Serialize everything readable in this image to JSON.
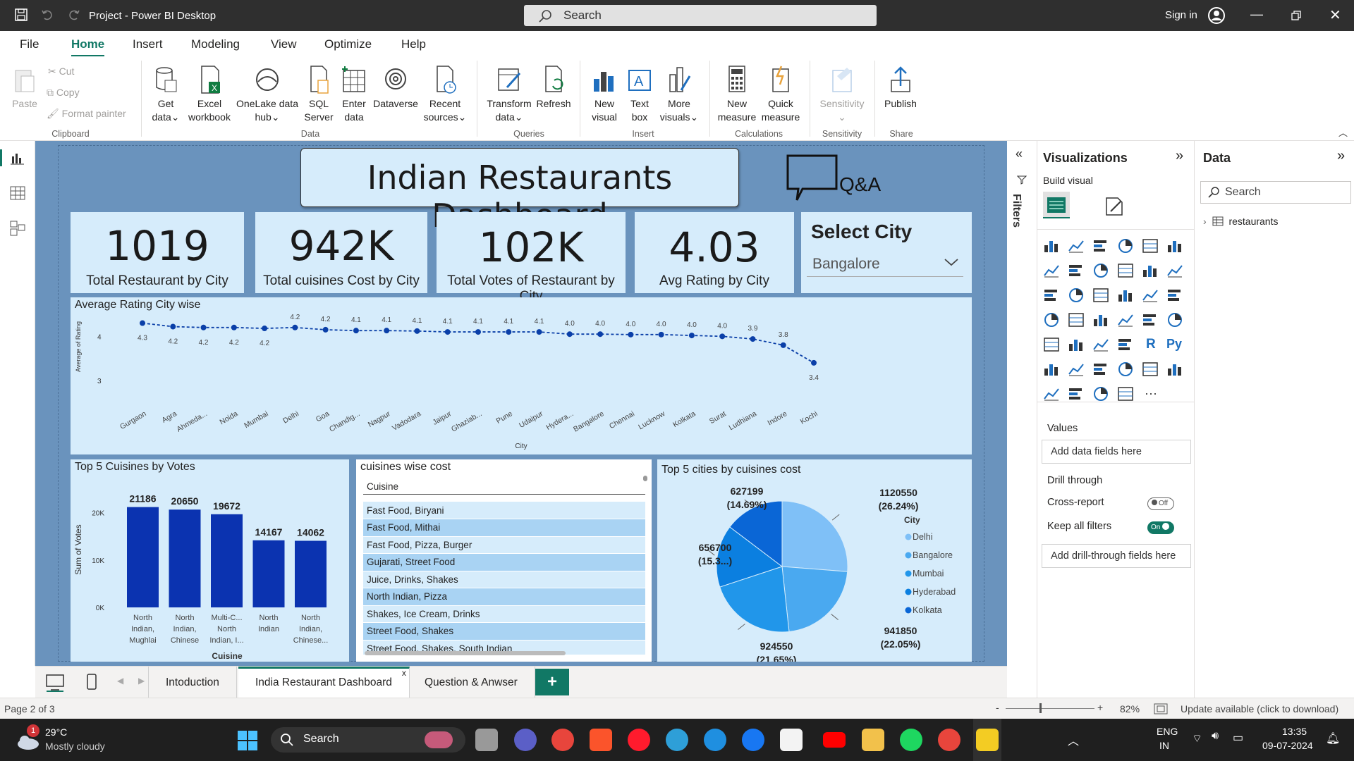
{
  "window": {
    "title": "Project - Power BI Desktop",
    "search_placeholder": "Search",
    "sign_in": "Sign in"
  },
  "menu": [
    "File",
    "Home",
    "Insert",
    "Modeling",
    "View",
    "Optimize",
    "Help"
  ],
  "ribbon": {
    "clipboard": {
      "paste": "Paste",
      "cut": "Cut",
      "copy": "Copy",
      "format_painter": "Format painter",
      "group": "Clipboard"
    },
    "data": {
      "get_data": [
        "Get",
        "data"
      ],
      "excel": [
        "Excel",
        "workbook"
      ],
      "onelake": [
        "OneLake data",
        "hub"
      ],
      "sql": [
        "SQL",
        "Server"
      ],
      "enter": [
        "Enter",
        "data"
      ],
      "dataverse": "Dataverse",
      "recent": [
        "Recent",
        "sources"
      ],
      "group": "Data"
    },
    "queries": {
      "transform": [
        "Transform",
        "data"
      ],
      "refresh": "Refresh",
      "group": "Queries"
    },
    "insert": {
      "new_visual": [
        "New",
        "visual"
      ],
      "text_box": [
        "Text",
        "box"
      ],
      "more_visuals": [
        "More",
        "visuals"
      ],
      "group": "Insert"
    },
    "calc": {
      "new_measure": [
        "New",
        "measure"
      ],
      "quick_measure": [
        "Quick",
        "measure"
      ],
      "group": "Calculations"
    },
    "sensitivity": {
      "label": "Sensitivity",
      "group": "Sensitivity"
    },
    "share": {
      "publish": "Publish",
      "group": "Share"
    }
  },
  "report": {
    "title": "Indian Restaurants Dashboard",
    "qa": "Q&A",
    "kpis": [
      {
        "value": "1019",
        "label": "Total Restaurant by City"
      },
      {
        "value": "942K",
        "label": "Total cuisines Cost by City"
      },
      {
        "value": "102K",
        "label": "Total Votes of Restaurant by City"
      },
      {
        "value": "4.03",
        "label": "Avg Rating by City"
      }
    ],
    "slicer": {
      "title": "Select City",
      "value": "Bangalore"
    },
    "cuisines_table": {
      "title": "cuisines wise cost",
      "header": "Cuisine",
      "rows": [
        "Fast Food, Biryani",
        "Fast Food, Mithai",
        "Fast Food, Pizza, Burger",
        "Gujarati, Street Food",
        "Juice, Drinks, Shakes",
        "North Indian, Pizza",
        "Shakes, Ice Cream, Drinks",
        "Street Food, Shakes",
        "Street Food, Shakes, South Indian"
      ]
    }
  },
  "chart_data": [
    {
      "type": "line",
      "title": "Average Rating City wise",
      "xlabel": "City",
      "ylabel": "Average of Rating",
      "ylim": [
        3,
        4.5
      ],
      "yticks": [
        "3",
        "4"
      ],
      "categories": [
        "Gurgaon",
        "Agra",
        "Ahmeda...",
        "Noida",
        "Mumbai",
        "Delhi",
        "Goa",
        "Chandig...",
        "Nagpur",
        "Vadodara",
        "Jaipur",
        "Ghaziab...",
        "Pune",
        "Udaipur",
        "Hydera...",
        "Bangalore",
        "Chennai",
        "Lucknow",
        "Kolkata",
        "Surat",
        "Ludhiana",
        "Indore",
        "Kochi"
      ],
      "values": [
        4.3,
        4.22,
        4.2,
        4.2,
        4.18,
        4.2,
        4.15,
        4.13,
        4.13,
        4.12,
        4.1,
        4.1,
        4.1,
        4.1,
        4.05,
        4.05,
        4.04,
        4.04,
        4.02,
        4.0,
        3.94,
        3.8,
        3.4
      ],
      "labels": [
        "4.3",
        "4.2",
        "4.2",
        "4.2",
        "4.2",
        "4.2",
        "4.2",
        "4.1",
        "4.1",
        "4.1",
        "4.1",
        "4.1",
        "4.1",
        "4.1",
        "4.0",
        "4.0",
        "4.0",
        "4.0",
        "4.0",
        "4.0",
        "3.9",
        "3.8",
        "3.4"
      ],
      "label_below": [
        true,
        true,
        true,
        true,
        true,
        false,
        false,
        false,
        false,
        false,
        false,
        false,
        false,
        false,
        false,
        false,
        false,
        false,
        false,
        false,
        false,
        false,
        true
      ],
      "grid": false,
      "color": "#0a3fa8"
    },
    {
      "type": "bar",
      "title": "Top 5 Cuisines by Votes",
      "xlabel": "Cuisine",
      "ylabel": "Sum of Votes",
      "ylim": [
        0,
        25000
      ],
      "yticks": [
        "0K",
        "10K",
        "20K"
      ],
      "categories": [
        [
          "North",
          "Indian,",
          "Mughlai"
        ],
        [
          "North",
          "Indian,",
          "Chinese"
        ],
        [
          "Multi-C...",
          "North",
          "Indian, I..."
        ],
        [
          "North",
          "Indian"
        ],
        [
          "North",
          "Indian,",
          "Chinese..."
        ]
      ],
      "values": [
        21186,
        20650,
        19672,
        14167,
        14062
      ],
      "labels": [
        "21186",
        "20650",
        "19672",
        "14167",
        "14062"
      ],
      "color": "#0b33b0"
    },
    {
      "type": "pie",
      "title": "Top 5 cities by cuisines cost",
      "legend_title": "City",
      "legend_position": "right",
      "categories": [
        "Delhi",
        "Bangalore",
        "Mumbai",
        "Hyderabad",
        "Kolkata"
      ],
      "values": [
        1120550,
        941850,
        924550,
        656700,
        627199
      ],
      "labels": [
        [
          "1120550",
          "(26.24%)"
        ],
        [
          "941850",
          "(22.05%)"
        ],
        [
          "924550",
          "(21.65%)"
        ],
        [
          "656700",
          "(15.3...)"
        ],
        [
          "627199",
          "(14.69%)"
        ]
      ],
      "colors": [
        "#7fc0f7",
        "#4aa9f0",
        "#2196ea",
        "#0b7fe0",
        "#0a66d6"
      ]
    }
  ],
  "filters_label": "Filters",
  "visualizations": {
    "title": "Visualizations",
    "build": "Build visual",
    "values": "Values",
    "add_fields": "Add data fields here",
    "drill": "Drill through",
    "cross_report": "Cross-report",
    "cross_state": "Off",
    "keep_filters": "Keep all filters",
    "keep_state": "On",
    "add_drill": "Add drill-through fields here"
  },
  "data_pane": {
    "title": "Data",
    "search": "Search",
    "table": "restaurants"
  },
  "tabs": [
    "Intoduction",
    "India Restaurant Dashboard",
    "Question & Anwser"
  ],
  "status": {
    "page": "Page 2 of 3",
    "zoom": "82%",
    "update": "Update available (click to download)"
  },
  "taskbar": {
    "temp": "29°C",
    "weather": "Mostly cloudy",
    "search": "Search",
    "lang1": "ENG",
    "lang2": "IN",
    "time": "13:35",
    "date": "09-07-2024",
    "badge": "1"
  }
}
